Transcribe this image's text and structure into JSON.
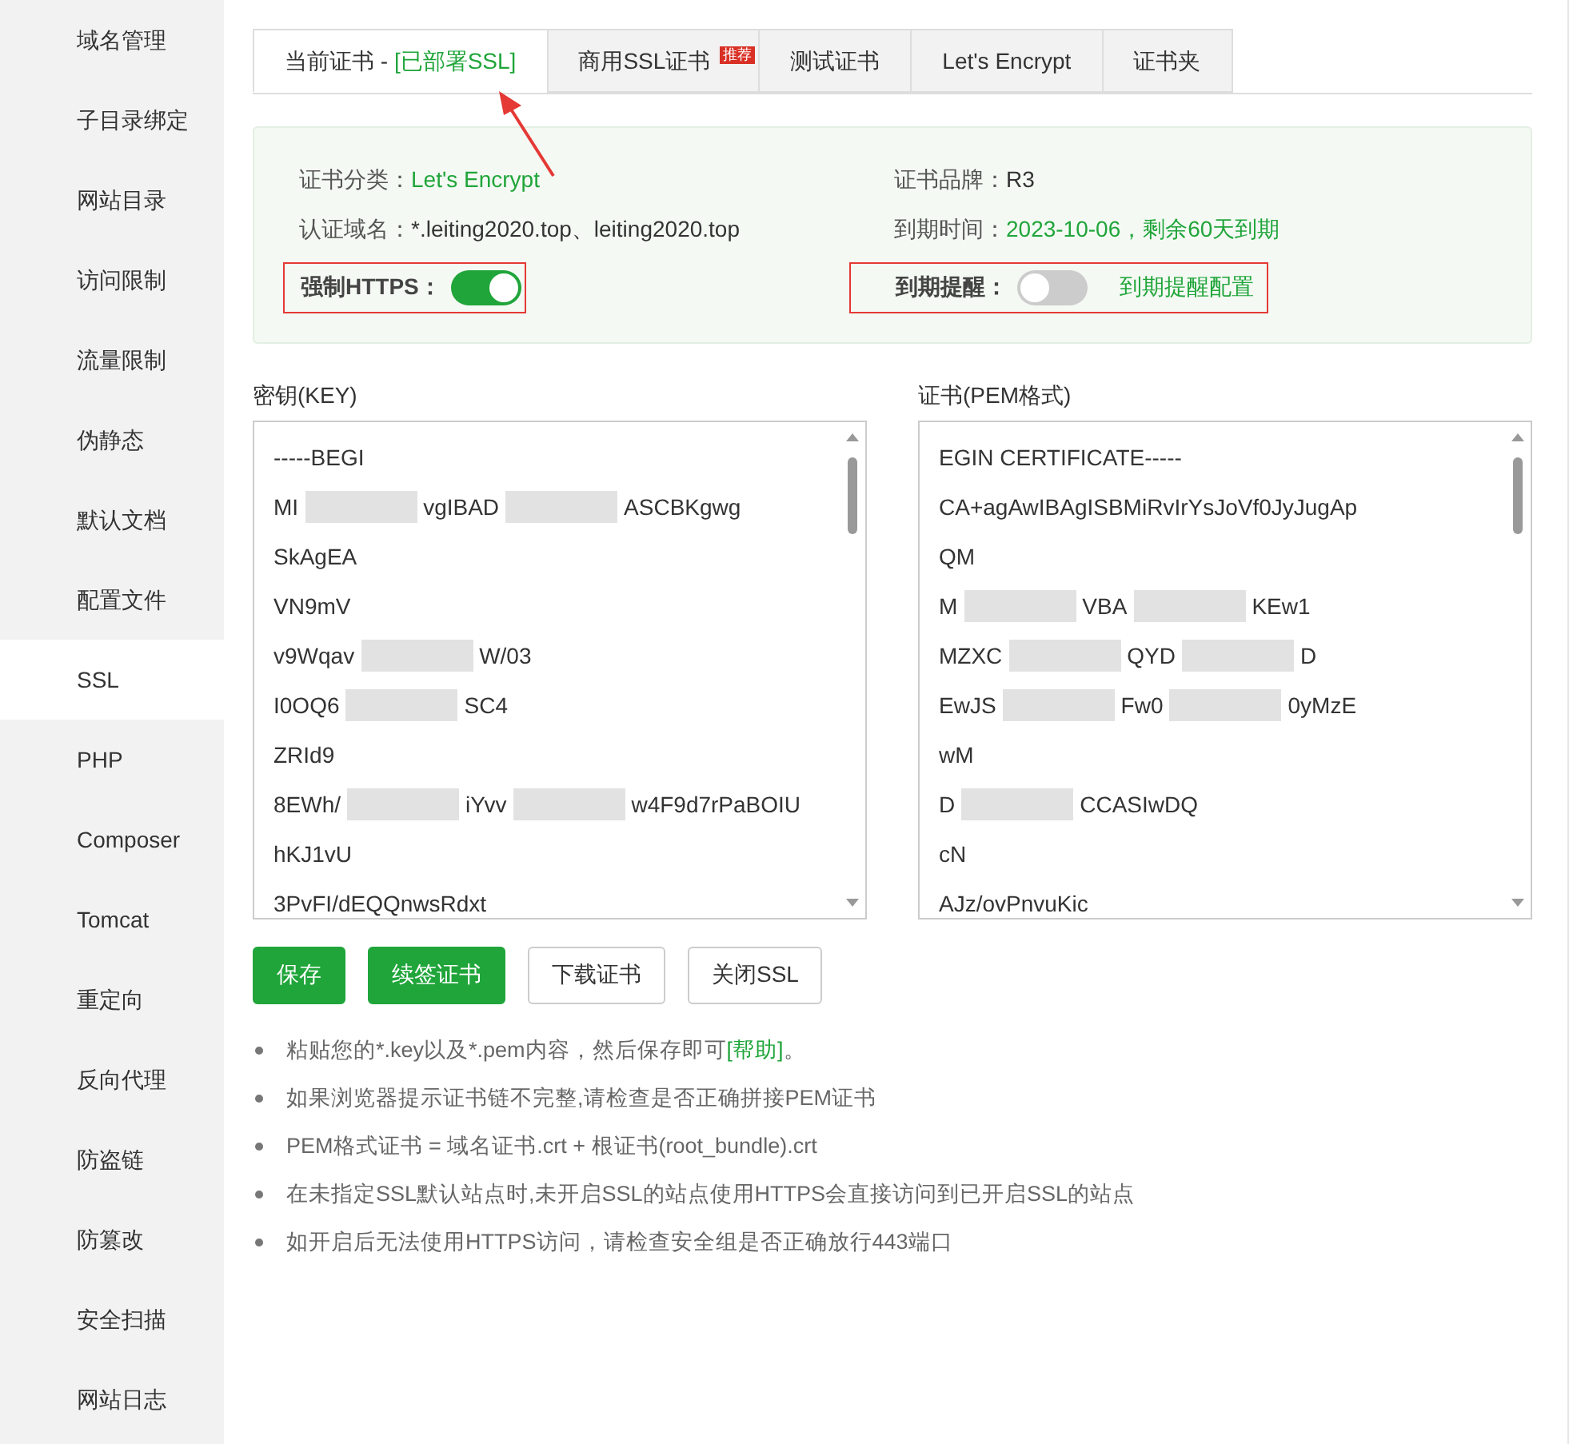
{
  "sidebar": {
    "items": [
      {
        "label": "域名管理",
        "selected": false
      },
      {
        "label": "子目录绑定",
        "selected": false
      },
      {
        "label": "网站目录",
        "selected": false
      },
      {
        "label": "访问限制",
        "selected": false
      },
      {
        "label": "流量限制",
        "selected": false
      },
      {
        "label": "伪静态",
        "selected": false
      },
      {
        "label": "默认文档",
        "selected": false
      },
      {
        "label": "配置文件",
        "selected": false
      },
      {
        "label": "SSL",
        "selected": true
      },
      {
        "label": "PHP",
        "selected": false
      },
      {
        "label": "Composer",
        "selected": false
      },
      {
        "label": "Tomcat",
        "selected": false
      },
      {
        "label": "重定向",
        "selected": false
      },
      {
        "label": "反向代理",
        "selected": false
      },
      {
        "label": "防盗链",
        "selected": false
      },
      {
        "label": "防篡改",
        "selected": false
      },
      {
        "label": "安全扫描",
        "selected": false
      },
      {
        "label": "网站日志",
        "selected": false
      }
    ]
  },
  "tabs": [
    {
      "label": "当前证书 - ",
      "status": "[已部署SSL]",
      "annotated": true,
      "selected": true
    },
    {
      "label": "商用SSL证书",
      "badge": "推荐",
      "selected": false
    },
    {
      "label": "测试证书",
      "selected": false
    },
    {
      "label": "Let's Encrypt",
      "selected": false
    },
    {
      "label": "证书夹",
      "selected": false
    }
  ],
  "info": {
    "left": [
      {
        "label": "证书分类：",
        "value": "Let's Encrypt",
        "accent": true
      },
      {
        "label": "认证域名：",
        "value": "*.leiting2020.top、leiting2020.top",
        "accent": false
      }
    ],
    "right": [
      {
        "label": "证书品牌：",
        "value": "R3",
        "accent": false
      },
      {
        "label": "到期时间：",
        "value": "2023-10-06，剩余60天到期",
        "accent": true
      }
    ],
    "force_https": {
      "label": "强制HTTPS：",
      "on": true,
      "annotated": true
    },
    "reminder": {
      "label": "到期提醒：",
      "on": false,
      "link": "到期提醒配置",
      "annotated": true
    }
  },
  "key": {
    "label": "密钥(KEY)",
    "lines": [
      [
        "-----BEGI"
      ],
      [
        "MI",
        "vgIBAD",
        "ASCBKgwg"
      ],
      [
        "SkAgEA"
      ],
      [
        "VN9mV"
      ],
      [
        "v9Wqav",
        "W/03"
      ],
      [
        "I0OQ6",
        "SC4"
      ],
      [
        "ZRId9"
      ],
      [
        "8EWh/",
        "iYvv",
        "w4F9d7rPaBOIU"
      ],
      [
        "hKJ1vU"
      ],
      [
        "3PvFI/dEQQnwsRdxt"
      ]
    ]
  },
  "cert": {
    "label": "证书(PEM格式)",
    "lines": [
      [
        "EGIN CERTIFICATE-----"
      ],
      [
        "CA+agAwIBAgISBMiRvIrYsJoVf0JyJugAp"
      ],
      [
        "QM"
      ],
      [
        "M",
        "VBA",
        "KEw1"
      ],
      [
        "MZXC",
        "QYD",
        "D"
      ],
      [
        "EwJS",
        "Fw0",
        "0yMzE"
      ],
      [
        "wM"
      ],
      [
        "D",
        "CCASIwDQ"
      ],
      [
        "cN"
      ],
      [
        "AJz/ovPnvuKic"
      ]
    ]
  },
  "buttons": [
    {
      "label": "保存",
      "kind": "primary"
    },
    {
      "label": "续签证书",
      "kind": "primary"
    },
    {
      "label": "下载证书",
      "kind": "plain"
    },
    {
      "label": "关闭SSL",
      "kind": "plain"
    }
  ],
  "notes": [
    {
      "text": "粘贴您的*.key以及*.pem内容，然后保存即可",
      "link": "[帮助]",
      "after": "。"
    },
    {
      "text": "如果浏览器提示证书链不完整,请检查是否正确拼接PEM证书"
    },
    {
      "text": "PEM格式证书 = 域名证书.crt + 根证书(root_bundle).crt"
    },
    {
      "text": "在未指定SSL默认站点时,未开启SSL的站点使用HTTPS会直接访问到已开启SSL的站点"
    },
    {
      "text": "如开启后无法使用HTTPS访问，请检查安全组是否正确放行443端口"
    }
  ]
}
